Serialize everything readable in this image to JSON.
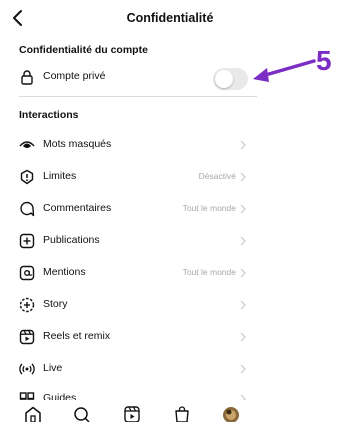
{
  "header": {
    "title": "Confidentialité",
    "back_icon": "chevron-left-icon"
  },
  "account_section": {
    "title": "Confidentialité du compte",
    "private_label": "Compte privé",
    "private_enabled": false
  },
  "interactions": {
    "title": "Interactions",
    "items": [
      {
        "label": "Mots masqués",
        "value": "",
        "icon": "eye-icon"
      },
      {
        "label": "Limites",
        "value": "Désactivé",
        "icon": "limits-icon"
      },
      {
        "label": "Commentaires",
        "value": "Tout le monde",
        "icon": "comment-icon"
      },
      {
        "label": "Publications",
        "value": "",
        "icon": "add-post-icon"
      },
      {
        "label": "Mentions",
        "value": "Tout le monde",
        "icon": "at-icon"
      },
      {
        "label": "Story",
        "value": "",
        "icon": "story-icon"
      },
      {
        "label": "Reels et remix",
        "value": "",
        "icon": "reels-icon"
      },
      {
        "label": "Live",
        "value": "",
        "icon": "live-icon"
      },
      {
        "label": "Guides",
        "value": "",
        "icon": "guides-icon"
      }
    ]
  },
  "annotation": {
    "number": "5",
    "color": "#7b2cc4"
  },
  "tabbar": [
    "home-icon",
    "search-icon",
    "reels-icon",
    "shop-icon",
    "profile-avatar"
  ]
}
